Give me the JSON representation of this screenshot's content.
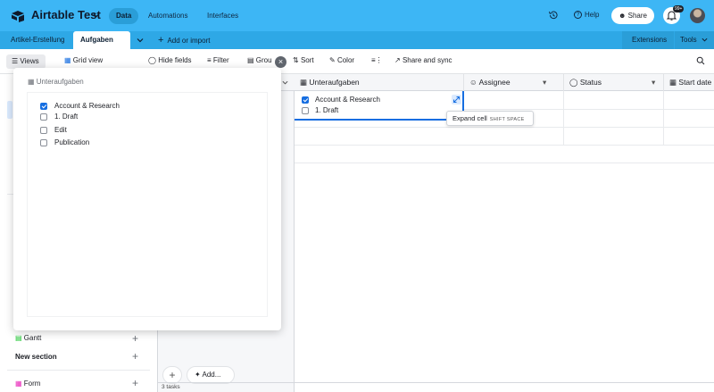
{
  "app": {
    "title": "Airtable Test",
    "nav": [
      "Data",
      "Automations",
      "Interfaces"
    ],
    "help": "Help",
    "share": "Share",
    "notif_badge": "99+"
  },
  "tables": {
    "tabs": [
      "Artikel-Erstellung",
      "Aufgaben"
    ],
    "add_import": "Add or import",
    "extensions": "Extensions",
    "tools": "Tools"
  },
  "toolbar": {
    "views": "Views",
    "grid_view": "Grid view",
    "hide_fields": "Hide fields",
    "filter": "Filter",
    "group": "Grou",
    "sort": "Sort",
    "color": "Color",
    "share_sync": "Share and sync"
  },
  "columns": [
    "Unteraufgaben",
    "Assignee",
    "Status",
    "Start date"
  ],
  "cell": {
    "items": [
      {
        "label": "Account & Research",
        "checked": true
      },
      {
        "label": "1. Draft",
        "checked": false
      }
    ],
    "tooltip": "Expand cell",
    "shortcut": "SHIFT SPACE"
  },
  "popover": {
    "title": "Unteraufgaben",
    "options": [
      {
        "label": "Account & Research",
        "checked": true
      },
      {
        "label": "1. Draft",
        "checked": false
      },
      {
        "label": "Edit",
        "checked": false
      },
      {
        "label": "Publication",
        "checked": false
      }
    ]
  },
  "sidebar": {
    "gantt": "Gantt",
    "new_section": "New section",
    "form": "Form"
  },
  "footer": {
    "add": "Add...",
    "count": "3 tasks"
  },
  "colors": {
    "topbar": "#3db6f5",
    "tablebar": "#2ea8e6",
    "accent": "#166ee1"
  }
}
